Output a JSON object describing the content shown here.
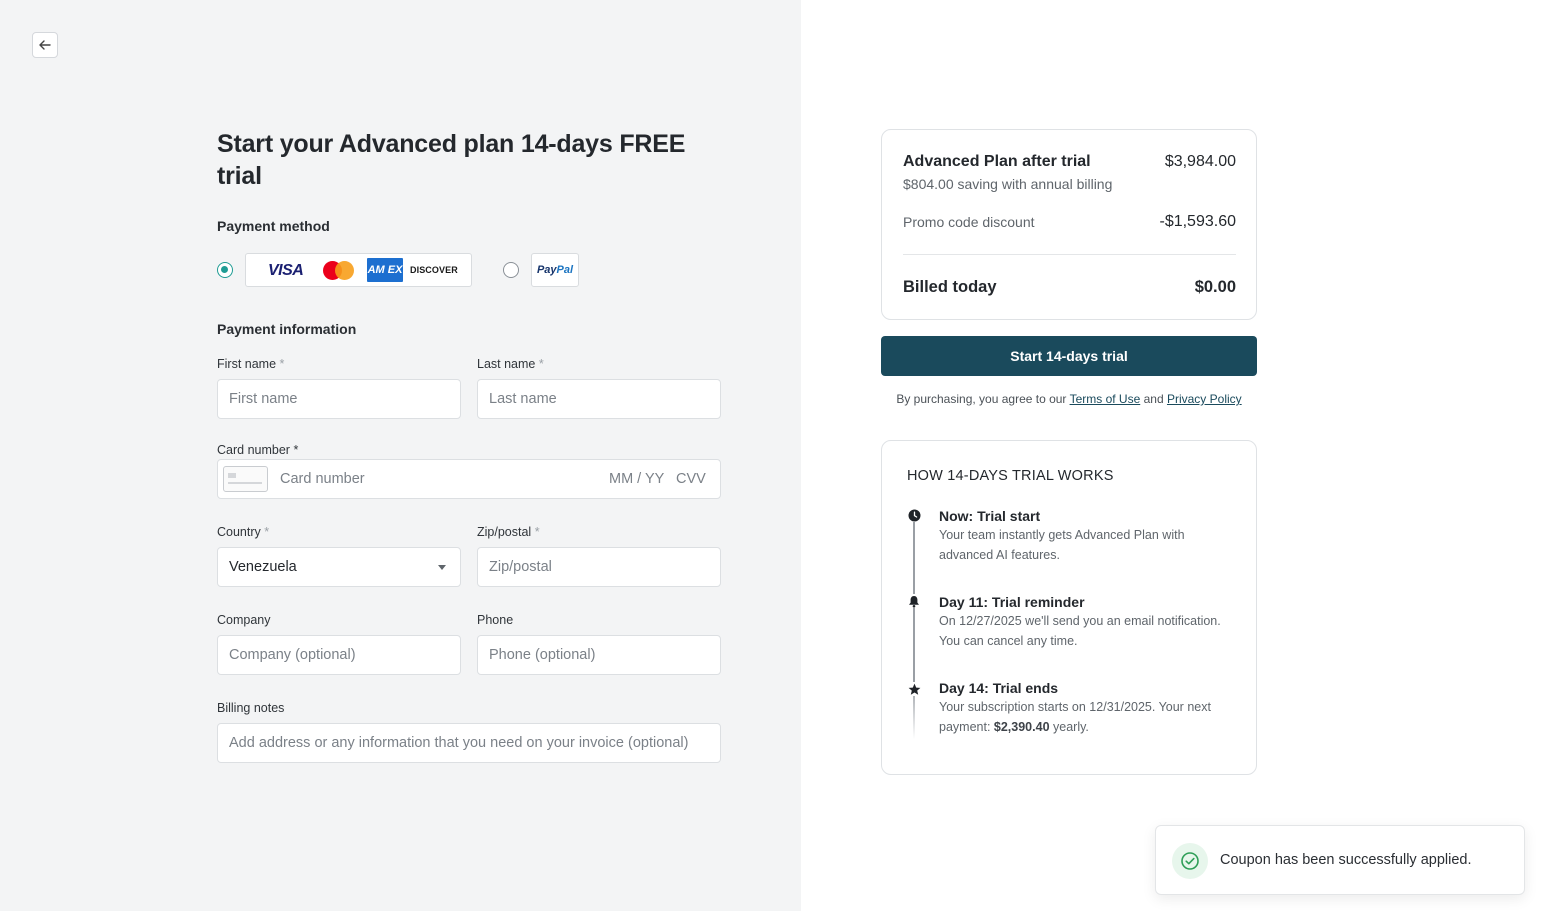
{
  "navigation": {
    "back_icon": "arrow-left-icon"
  },
  "page": {
    "title": "Start your Advanced plan 14-days FREE trial"
  },
  "payment_method": {
    "label": "Payment method",
    "options": [
      {
        "id": "card",
        "selected": true,
        "brands": [
          "VISA",
          "Mastercard",
          "AM EX",
          "DISCOVER"
        ]
      },
      {
        "id": "paypal",
        "selected": false,
        "brand_a": "Pay",
        "brand_b": "Pal"
      }
    ]
  },
  "payment_info": {
    "label": "Payment information",
    "required_mark": "*",
    "first_name": {
      "label": "First name",
      "placeholder": "First name"
    },
    "last_name": {
      "label": "Last name",
      "placeholder": "Last name"
    },
    "card_number": {
      "label": "Card number",
      "placeholder": "Card number",
      "expiry_placeholder": "MM / YY",
      "cvv_placeholder": "CVV"
    },
    "country": {
      "label": "Country",
      "value": "Venezuela"
    },
    "zip": {
      "label": "Zip/postal",
      "placeholder": "Zip/postal"
    },
    "company": {
      "label": "Company",
      "placeholder": "Company (optional)"
    },
    "phone": {
      "label": "Phone",
      "placeholder": "Phone (optional)"
    },
    "billing_notes": {
      "label": "Billing notes",
      "placeholder": "Add address or any information that you need on your invoice (optional)"
    }
  },
  "summary": {
    "plan_name": "Advanced Plan after trial",
    "plan_price": "$3,984.00",
    "saving_text": "$804.00 saving with annual billing",
    "promo_label": "Promo code discount",
    "promo_value": "-$1,593.60",
    "billed_label": "Billed today",
    "billed_value": "$0.00"
  },
  "cta": {
    "label": "Start 14-days trial"
  },
  "legal": {
    "prefix": "By purchasing, you agree to our",
    "terms": "Terms of Use",
    "and": "and",
    "privacy": "Privacy Policy"
  },
  "how_it_works": {
    "title": "HOW 14-DAYS TRIAL WORKS",
    "steps": [
      {
        "icon": "clock-icon",
        "title": "Now: Trial start",
        "desc_a": "Your team instantly gets Advanced Plan with",
        "desc_b": "advanced AI features."
      },
      {
        "icon": "bell-icon",
        "title": "Day 11: Trial reminder",
        "desc_a": "On 12/27/2025 we'll send you an email notification.",
        "desc_b": "You can cancel any time."
      },
      {
        "icon": "star-icon",
        "title": "Day 14: Trial ends",
        "desc_a": "Your subscription starts on 12/31/2025. Your next",
        "desc_b_pre": "payment:",
        "desc_b_bold": "$2,390.40",
        "desc_b_post": "yearly."
      }
    ]
  },
  "toast": {
    "icon": "check-circle-icon",
    "message": "Coupon has been successfully applied."
  },
  "colors": {
    "accent": "#1a4a5c",
    "radio": "#1f9c94",
    "left_bg": "#f3f4f5"
  }
}
